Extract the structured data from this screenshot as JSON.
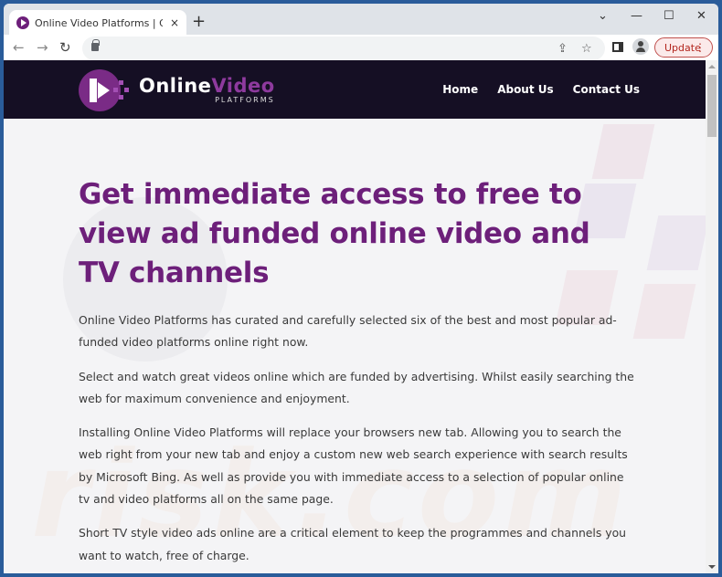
{
  "browser": {
    "tab": {
      "title": "Online Video Platforms | Get imm",
      "close_icon": "×"
    },
    "new_tab_icon": "+",
    "window_controls": {
      "tab_search": "⌄",
      "minimize": "—",
      "maximize": "☐",
      "close": "✕"
    },
    "toolbar": {
      "back": "←",
      "forward": "→",
      "reload": "↻",
      "share_icon": "⇪",
      "bookmark_icon": "☆",
      "update_label": "Update",
      "menu_icon": "⋮"
    }
  },
  "site": {
    "logo": {
      "main_white": "Online",
      "main_purple": "Video",
      "sub": "PLATFORMS"
    },
    "nav": [
      {
        "label": "Home"
      },
      {
        "label": "About Us"
      },
      {
        "label": "Contact Us"
      }
    ],
    "hero_title": "Get immediate access to free to view ad funded online video and TV channels",
    "paragraphs": [
      "Online Video Platforms has curated and carefully selected six of the best and most popular ad-funded video platforms online right now.",
      "Select and watch great videos online which are funded by advertising. Whilst easily searching the web for maximum convenience and enjoyment.",
      "Installing Online Video Platforms will replace your browsers new tab. Allowing you to search the web right from your new tab and enjoy a custom new web search experience with search results by Microsoft Bing. As well as provide you with immediate access to a selection of popular online tv and video platforms all on the same page.",
      "Short TV style video ads online are a critical element to keep the programmes and channels you want to watch, free of charge."
    ],
    "watermark_text": "risk.com",
    "colors": {
      "header_bg": "#150f24",
      "accent_purple": "#6d1f7a",
      "update_red": "#b3261e"
    }
  }
}
